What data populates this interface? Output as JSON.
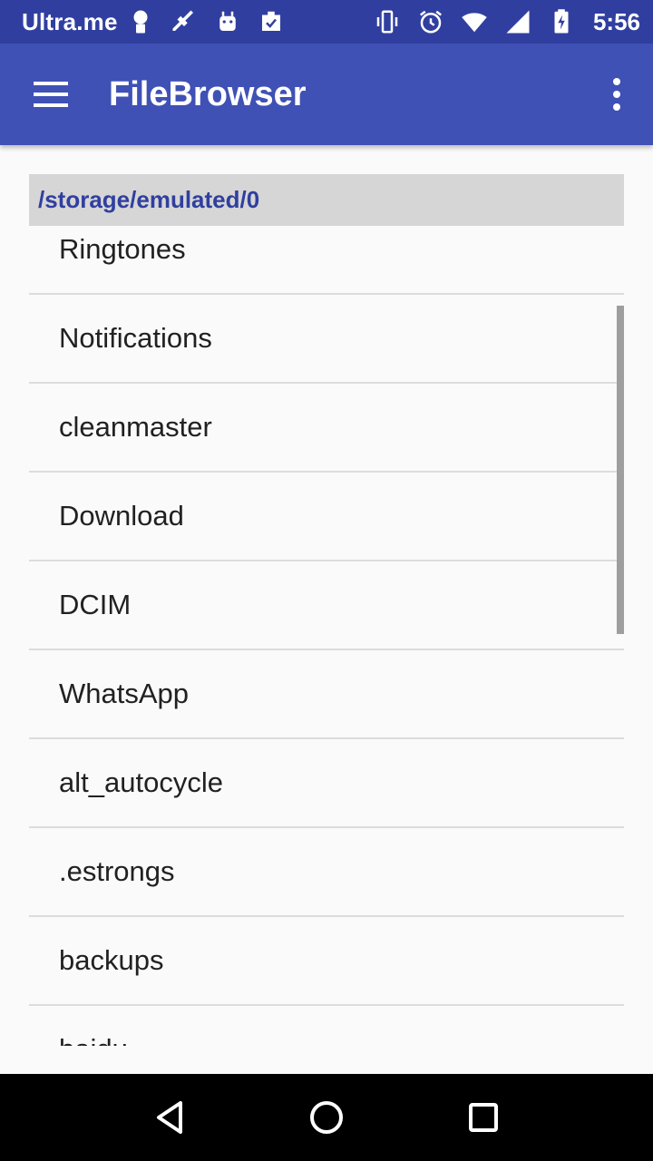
{
  "status_bar": {
    "carrier": "Ultra.me",
    "time": "5:56",
    "left_icons": [
      "ultra-sim-icon",
      "cleaner-icon",
      "android-icon",
      "clipboard-check-icon"
    ],
    "right_icons": [
      "vibrate-icon",
      "alarm-icon",
      "wifi-icon",
      "signal-icon",
      "battery-charging-icon"
    ]
  },
  "app_bar": {
    "title": "FileBrowser",
    "menu_icon": "hamburger-menu-icon",
    "overflow_icon": "more-vert-icon"
  },
  "path": "/storage/emulated/0",
  "files": [
    {
      "name": "Ringtones"
    },
    {
      "name": "Notifications"
    },
    {
      "name": "cleanmaster"
    },
    {
      "name": "Download"
    },
    {
      "name": "DCIM"
    },
    {
      "name": "WhatsApp"
    },
    {
      "name": "alt_autocycle"
    },
    {
      "name": ".estrongs"
    },
    {
      "name": "backups"
    },
    {
      "name": "baidu"
    }
  ],
  "nav_bar": {
    "back_icon": "back-icon",
    "home_icon": "home-icon",
    "recents_icon": "recents-icon"
  },
  "colors": {
    "status_bar": "#303f9f",
    "app_bar": "#3f51b5",
    "path_text": "#303f9f",
    "path_bg": "#d6d6d6"
  }
}
